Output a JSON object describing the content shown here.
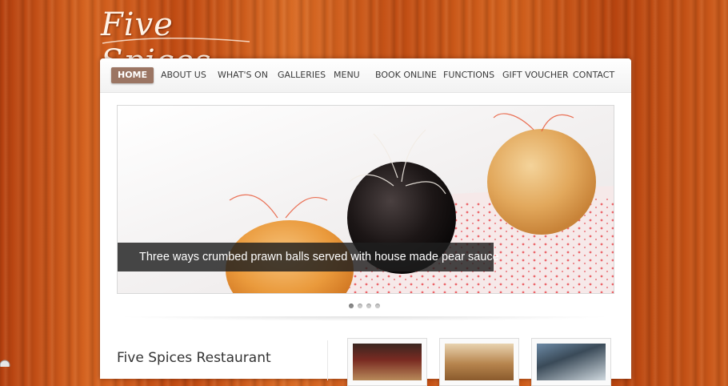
{
  "site": {
    "logo_text": "Five Spices"
  },
  "nav": {
    "items": [
      {
        "label": "Home",
        "active": true
      },
      {
        "label": "About Us"
      },
      {
        "label": "What's On"
      },
      {
        "label": "Galleries"
      },
      {
        "label": "Menu"
      },
      {
        "label": "Book Online"
      },
      {
        "label": "Functions"
      },
      {
        "label": "Gift Voucher"
      },
      {
        "label": "Contact"
      }
    ]
  },
  "slider": {
    "caption": "Three ways crumbed prawn balls served with house made pear sauce",
    "slide_count": 4,
    "active_slide": 1
  },
  "content": {
    "section_title": "Five Spices Restaurant",
    "thumbnails": [
      "restaurant-interior-photo",
      "dining-room-photo",
      "building-exterior-photo"
    ]
  },
  "colors": {
    "nav_active_bg": "#9b7563",
    "wood": "#c8541a",
    "caption_bg": "#1e1e1e"
  }
}
